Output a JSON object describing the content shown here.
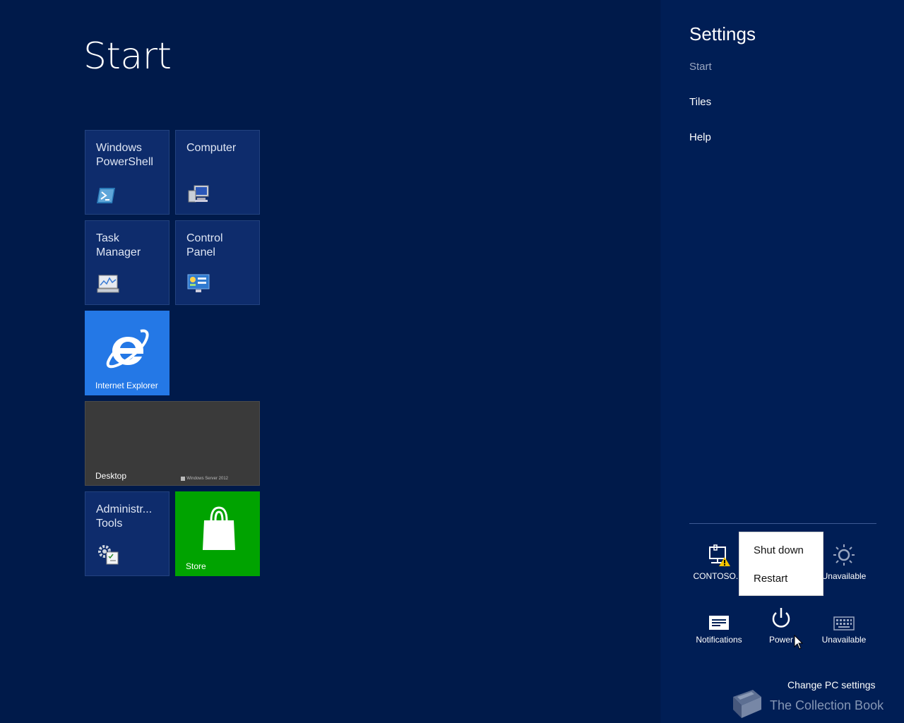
{
  "start": {
    "title": "Start"
  },
  "tiles": {
    "powershell": "Windows\nPowerShell",
    "computer": "Computer",
    "task_manager": "Task\nManager",
    "control_panel": "Control\nPanel",
    "ie": "Internet Explorer",
    "desktop": "Desktop",
    "desktop_brand": "Windows Server 2012",
    "admin_tools": "Administr...\nTools",
    "store": "Store"
  },
  "settings": {
    "title": "Settings",
    "subtitle": "Start",
    "links": [
      "Tiles",
      "Help"
    ],
    "quick": {
      "network": "CONTOSO.lo",
      "volume": "Unavailable",
      "notifications": "Notifications",
      "power": "Power",
      "keyboard": "Unavailable"
    },
    "power_menu": [
      "Shut down",
      "Restart"
    ],
    "change_pc_settings": "Change PC settings"
  },
  "watermark": "The Collection Book",
  "colors": {
    "background": "#001a4a",
    "tile": "#0e2c6c",
    "ie_tile": "#2478e6",
    "desktop_tile": "#3a3a3a",
    "store_tile": "#00a300"
  }
}
